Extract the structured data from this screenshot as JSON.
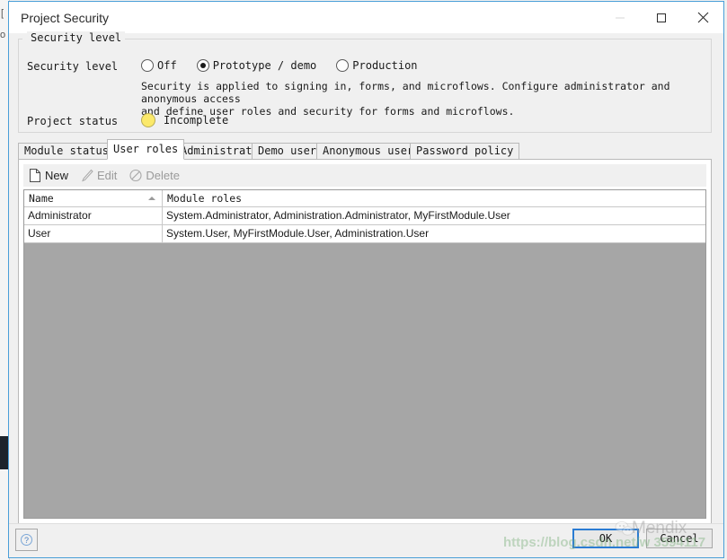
{
  "backdrop": {
    "fragment_top": "[",
    "fragment_below": "o"
  },
  "window": {
    "title": "Project Security",
    "controls": [
      {
        "name": "minimize",
        "glyph": "minimize-icon",
        "enabled": false
      },
      {
        "name": "maximize",
        "glyph": "maximize-icon",
        "enabled": true
      },
      {
        "name": "close",
        "glyph": "close-icon",
        "enabled": true
      }
    ]
  },
  "security_group": {
    "legend": "Security level",
    "level_label": "Security level",
    "options": [
      {
        "label": "Off",
        "checked": false
      },
      {
        "label": "Prototype / demo",
        "checked": true
      },
      {
        "label": "Production",
        "checked": false
      }
    ],
    "description": "Security is applied to signing in, forms, and microflows. Configure administrator and anonymous access\nand define user roles and security for forms and microflows.",
    "status_label": "Project status",
    "status_value": "Incomplete",
    "status_color": "#fbe96a"
  },
  "tabs": [
    {
      "label": "Module status",
      "active": false
    },
    {
      "label": "User roles",
      "active": true
    },
    {
      "label": "Administrator",
      "active": false
    },
    {
      "label": "Demo users",
      "active": false
    },
    {
      "label": "Anonymous users",
      "active": false
    },
    {
      "label": "Password policy",
      "active": false
    }
  ],
  "toolbar": [
    {
      "label": "New",
      "icon": "new-document-icon",
      "enabled": true
    },
    {
      "label": "Edit",
      "icon": "pencil-icon",
      "enabled": false
    },
    {
      "label": "Delete",
      "icon": "no-entry-icon",
      "enabled": false
    }
  ],
  "grid": {
    "columns": [
      "Name",
      "Module roles"
    ],
    "sort_column": "Name",
    "sort_direction": "ascending",
    "rows": [
      {
        "name": "Administrator",
        "module_roles": "System.Administrator, Administration.Administrator, MyFirstModule.User"
      },
      {
        "name": "User",
        "module_roles": "System.User, MyFirstModule.User, Administration.User"
      }
    ],
    "empty_background": "#a6a6a6"
  },
  "footer": {
    "help_label": "?",
    "ok_label": "OK",
    "cancel_label": "Cancel",
    "focus_color": "#2b7cd3"
  },
  "watermarks": {
    "url": "https://blog.csdn.net/w   3594117",
    "brand": "Mendix"
  }
}
